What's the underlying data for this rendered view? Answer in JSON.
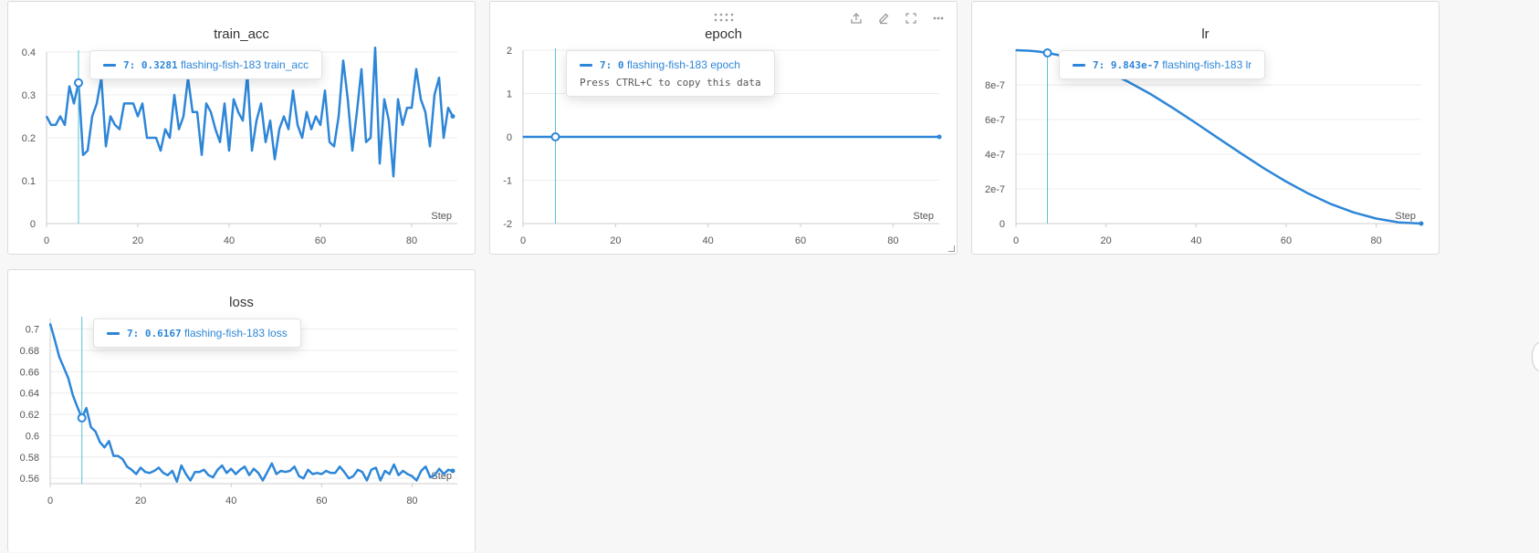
{
  "colors": {
    "series": "#2e86d8",
    "crosshair": "#5bc0d0",
    "grid": "#ececec"
  },
  "step_label": "Step",
  "series_name": "flashing-fish-183",
  "toolbar_icons": [
    "share-icon",
    "edit-icon",
    "fullscreen-icon",
    "more-icon"
  ],
  "charts": [
    {
      "id": "train_acc",
      "title": "train_acc",
      "tooltip": {
        "step": "7",
        "value": "0.3281",
        "series": "flashing-fish-183",
        "metric": "train_acc",
        "hint": ""
      },
      "chart_data": {
        "type": "line",
        "xlim": [
          0,
          90
        ],
        "ylim": [
          0,
          0.4
        ],
        "xticks": [
          0,
          20,
          40,
          60,
          80
        ],
        "yticks": [
          0,
          0.1,
          0.2,
          0.3,
          0.4
        ],
        "ytick_labels": [
          "0",
          "0.1",
          "0.2",
          "0.3",
          "0.4"
        ],
        "xlabel": "Step",
        "ylabel": "",
        "highlight_step": 7,
        "series": [
          {
            "name": "flashing-fish-183",
            "x": [
              0,
              1,
              2,
              3,
              4,
              5,
              6,
              7,
              8,
              9,
              10,
              11,
              12,
              13,
              14,
              15,
              16,
              17,
              18,
              19,
              20,
              21,
              22,
              23,
              24,
              25,
              26,
              27,
              28,
              29,
              30,
              31,
              32,
              33,
              34,
              35,
              36,
              37,
              38,
              39,
              40,
              41,
              42,
              43,
              44,
              45,
              46,
              47,
              48,
              49,
              50,
              51,
              52,
              53,
              54,
              55,
              56,
              57,
              58,
              59,
              60,
              61,
              62,
              63,
              64,
              65,
              66,
              67,
              68,
              69,
              70,
              71,
              72,
              73,
              74,
              75,
              76,
              77,
              78,
              79,
              80,
              81,
              82,
              83,
              84,
              85,
              86,
              87,
              88,
              89
            ],
            "y": [
              0.25,
              0.23,
              0.23,
              0.25,
              0.23,
              0.32,
              0.28,
              0.3281,
              0.16,
              0.17,
              0.25,
              0.28,
              0.34,
              0.18,
              0.25,
              0.23,
              0.22,
              0.28,
              0.28,
              0.28,
              0.25,
              0.28,
              0.2,
              0.2,
              0.2,
              0.17,
              0.22,
              0.2,
              0.3,
              0.22,
              0.25,
              0.34,
              0.26,
              0.26,
              0.16,
              0.28,
              0.26,
              0.22,
              0.19,
              0.28,
              0.17,
              0.29,
              0.26,
              0.24,
              0.35,
              0.17,
              0.24,
              0.28,
              0.19,
              0.24,
              0.15,
              0.22,
              0.25,
              0.22,
              0.31,
              0.23,
              0.2,
              0.26,
              0.22,
              0.25,
              0.23,
              0.31,
              0.19,
              0.18,
              0.25,
              0.38,
              0.29,
              0.17,
              0.26,
              0.36,
              0.19,
              0.2,
              0.41,
              0.14,
              0.29,
              0.24,
              0.11,
              0.29,
              0.23,
              0.27,
              0.27,
              0.36,
              0.29,
              0.26,
              0.18,
              0.3,
              0.34,
              0.2,
              0.27,
              0.25
            ]
          }
        ]
      }
    },
    {
      "id": "epoch",
      "title": "epoch",
      "tooltip": {
        "step": "7",
        "value": "0",
        "series": "flashing-fish-183",
        "metric": "epoch",
        "hint": "Press CTRL+C to copy this data"
      },
      "chart_data": {
        "type": "line",
        "xlim": [
          0,
          90
        ],
        "ylim": [
          -2,
          2
        ],
        "xticks": [
          0,
          20,
          40,
          60,
          80
        ],
        "yticks": [
          -2,
          -1,
          0,
          1,
          2
        ],
        "ytick_labels": [
          "-2",
          "-1",
          "0",
          "1",
          "2"
        ],
        "xlabel": "Step",
        "ylabel": "",
        "highlight_step": 7,
        "series": [
          {
            "name": "flashing-fish-183",
            "x": [
              0,
              90
            ],
            "y": [
              0,
              0
            ]
          }
        ]
      }
    },
    {
      "id": "lr",
      "title": "lr",
      "tooltip": {
        "step": "7",
        "value": "9.843e-7",
        "series": "flashing-fish-183",
        "metric": "lr",
        "hint": ""
      },
      "chart_data": {
        "type": "line",
        "xlim": [
          0,
          90
        ],
        "ylim": [
          0,
          1e-06
        ],
        "xticks": [
          0,
          20,
          40,
          60,
          80
        ],
        "yticks": [
          0,
          2e-07,
          4e-07,
          6e-07,
          8e-07
        ],
        "ytick_labels": [
          "0",
          "2e-7",
          "4e-7",
          "6e-7",
          "8e-7"
        ],
        "xlabel": "Step",
        "ylabel": "",
        "highlight_step": 7,
        "series": [
          {
            "name": "flashing-fish-183",
            "x": [
              0,
              3,
              5,
              7,
              10,
              15,
              20,
              25,
              30,
              35,
              40,
              45,
              50,
              55,
              60,
              65,
              70,
              75,
              80,
              85,
              90
            ],
            "y": [
              1e-06,
              9.97e-07,
              9.92e-07,
              9.843e-07,
              9.69e-07,
              9.31e-07,
              8.8e-07,
              8.17e-07,
              7.45e-07,
              6.64e-07,
              5.79e-07,
              4.91e-07,
              4.04e-07,
              3.2e-07,
              2.42e-07,
              1.72e-07,
              1.12e-07,
              6.4e-08,
              2.9e-08,
              7e-09,
              0
            ]
          }
        ]
      }
    },
    {
      "id": "loss",
      "title": "loss",
      "tooltip": {
        "step": "7",
        "value": "0.6167",
        "series": "flashing-fish-183",
        "metric": "loss",
        "hint": ""
      },
      "chart_data": {
        "type": "line",
        "xlim": [
          0,
          90
        ],
        "ylim": [
          0.555,
          0.71
        ],
        "xticks": [
          0,
          20,
          40,
          60,
          80
        ],
        "yticks": [
          0.56,
          0.58,
          0.6,
          0.62,
          0.64,
          0.66,
          0.68,
          0.7
        ],
        "ytick_labels": [
          "0.56",
          "0.58",
          "0.6",
          "0.62",
          "0.64",
          "0.66",
          "0.68",
          "0.7"
        ],
        "xlabel": "Step",
        "ylabel": "",
        "highlight_step": 7,
        "series": [
          {
            "name": "flashing-fish-183",
            "x": [
              0,
              1,
              2,
              3,
              4,
              5,
              6,
              7,
              8,
              9,
              10,
              11,
              12,
              13,
              14,
              15,
              16,
              17,
              18,
              19,
              20,
              21,
              22,
              23,
              24,
              25,
              26,
              27,
              28,
              29,
              30,
              31,
              32,
              33,
              34,
              35,
              36,
              37,
              38,
              39,
              40,
              41,
              42,
              43,
              44,
              45,
              46,
              47,
              48,
              49,
              50,
              51,
              52,
              53,
              54,
              55,
              56,
              57,
              58,
              59,
              60,
              61,
              62,
              63,
              64,
              65,
              66,
              67,
              68,
              69,
              70,
              71,
              72,
              73,
              74,
              75,
              76,
              77,
              78,
              79,
              80,
              81,
              82,
              83,
              84,
              85,
              86,
              87,
              88,
              89
            ],
            "y": [
              0.705,
              0.69,
              0.674,
              0.664,
              0.654,
              0.638,
              0.627,
              0.6167,
              0.626,
              0.608,
              0.604,
              0.594,
              0.589,
              0.595,
              0.581,
              0.581,
              0.578,
              0.571,
              0.568,
              0.564,
              0.57,
              0.566,
              0.565,
              0.567,
              0.57,
              0.565,
              0.563,
              0.567,
              0.557,
              0.572,
              0.564,
              0.558,
              0.566,
              0.566,
              0.568,
              0.563,
              0.561,
              0.568,
              0.572,
              0.565,
              0.569,
              0.564,
              0.568,
              0.571,
              0.563,
              0.569,
              0.565,
              0.558,
              0.566,
              0.574,
              0.564,
              0.567,
              0.566,
              0.567,
              0.571,
              0.562,
              0.56,
              0.568,
              0.564,
              0.565,
              0.564,
              0.567,
              0.565,
              0.565,
              0.571,
              0.566,
              0.56,
              0.562,
              0.568,
              0.566,
              0.558,
              0.568,
              0.57,
              0.558,
              0.567,
              0.564,
              0.573,
              0.563,
              0.567,
              0.564,
              0.562,
              0.558,
              0.567,
              0.571,
              0.561,
              0.563,
              0.569,
              0.564,
              0.568,
              0.567
            ]
          }
        ]
      }
    }
  ]
}
